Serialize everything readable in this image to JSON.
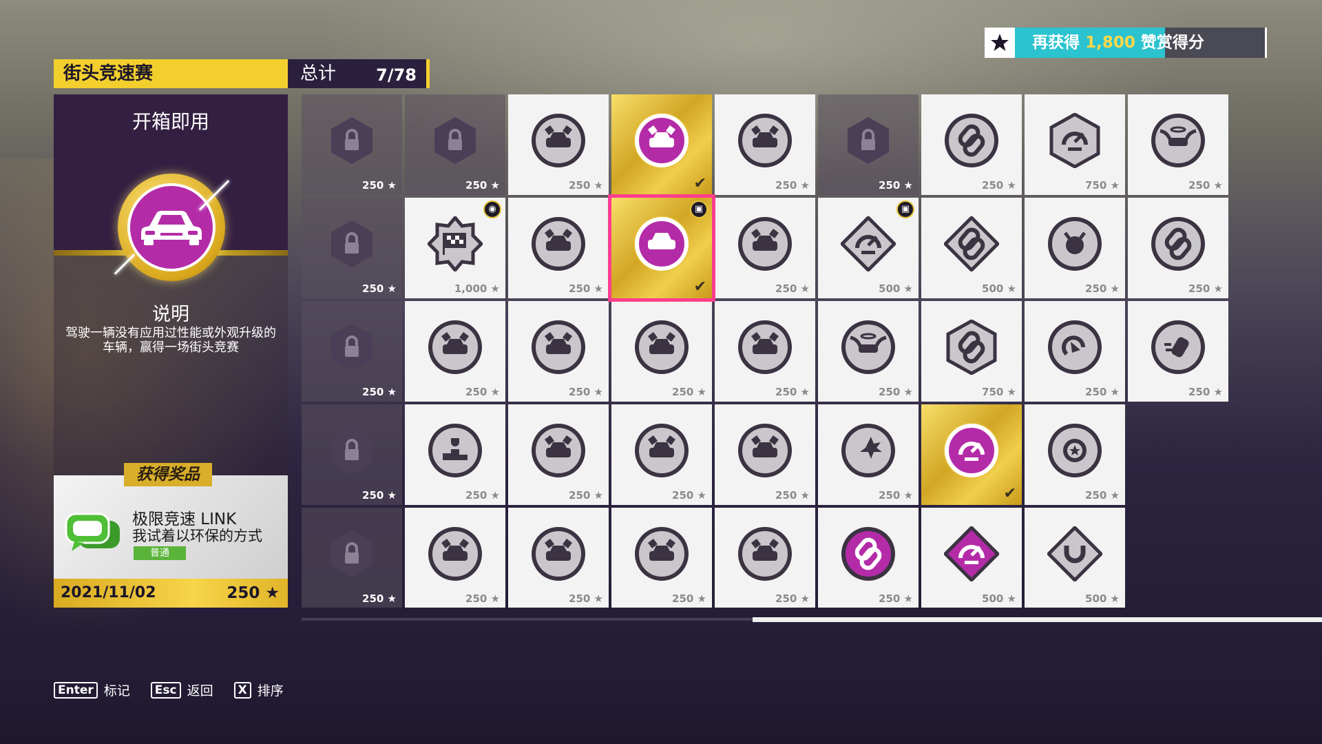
{
  "reward_progress": {
    "prefix": "再获得",
    "amount": "1,800",
    "suffix": "赞赏得分",
    "progress_fraction": 0.6
  },
  "header": {
    "category": "街头竞速赛",
    "total_label": "总计",
    "total_count": "7/78"
  },
  "detail": {
    "name": "开箱即用",
    "desc_heading": "说明",
    "description": "驾驶一辆没有应用过性能或外观升级的车辆，赢得一场街头竞赛",
    "reward_heading": "获得奖品",
    "reward_name": "极限竞速 LINK",
    "reward_subtitle": "我试着以环保的方式",
    "reward_rarity": "普通",
    "date": "2021/11/02",
    "points": "250 ★"
  },
  "colors": {
    "accent_yellow": "#f3cf2e",
    "purple": "#b42ba8",
    "select_pink": "#ff3d8f",
    "progress_cyan": "#2bc3cf"
  },
  "tiles": [
    [
      {
        "state": "locked",
        "points": "250 ★",
        "icon": "lock-icon"
      },
      {
        "state": "locked",
        "points": "250 ★",
        "icon": "lock-icon"
      },
      {
        "state": "normal",
        "points": "250 ★",
        "icon": "race-car-flags-icon"
      },
      {
        "state": "gold",
        "points": "",
        "icon": "race-car-flags-icon",
        "completed": true
      },
      {
        "state": "normal",
        "points": "250 ★",
        "icon": "race-car-flags-icon"
      },
      {
        "state": "locked",
        "points": "250 ★",
        "icon": "lock-icon"
      },
      {
        "state": "normal",
        "points": "250 ★",
        "icon": "chain-link-icon"
      },
      {
        "state": "normal",
        "points": "750 ★",
        "icon": "speedometer-icon",
        "shape": "hex"
      },
      {
        "state": "normal",
        "points": "250 ★",
        "icon": "winged-car-icon"
      }
    ],
    [
      {
        "state": "locked",
        "points": "250 ★",
        "icon": "lock-icon"
      },
      {
        "state": "normal",
        "points": "1,000 ★",
        "icon": "checkered-flag-icon",
        "shape": "star",
        "corner": "car-reward-icon"
      },
      {
        "state": "normal",
        "points": "250 ★",
        "icon": "race-car-flags-icon"
      },
      {
        "state": "gold",
        "points": "",
        "icon": "car-icon",
        "completed": true,
        "selected": true,
        "corner": "gift-icon"
      },
      {
        "state": "normal",
        "points": "250 ★",
        "icon": "race-car-flags-icon"
      },
      {
        "state": "normal",
        "points": "500 ★",
        "icon": "speedometer-icon",
        "shape": "diamond",
        "corner": "gift-icon"
      },
      {
        "state": "normal",
        "points": "500 ★",
        "icon": "chain-link-icon",
        "shape": "diamond"
      },
      {
        "state": "normal",
        "points": "250 ★",
        "icon": "devil-icon"
      },
      {
        "state": "normal",
        "points": "250 ★",
        "icon": "chain-link-icon"
      }
    ],
    [
      {
        "state": "locked",
        "points": "250 ★",
        "icon": "lock-icon"
      },
      {
        "state": "normal",
        "points": "250 ★",
        "icon": "race-car-flags-icon"
      },
      {
        "state": "normal",
        "points": "250 ★",
        "icon": "race-car-flags-icon"
      },
      {
        "state": "normal",
        "points": "250 ★",
        "icon": "race-car-flags-icon"
      },
      {
        "state": "normal",
        "points": "250 ★",
        "icon": "race-car-flags-icon"
      },
      {
        "state": "normal",
        "points": "250 ★",
        "icon": "winged-car-icon"
      },
      {
        "state": "normal",
        "points": "750 ★",
        "icon": "chain-link-icon",
        "shape": "hex"
      },
      {
        "state": "normal",
        "points": "250 ★",
        "icon": "drift-icon"
      },
      {
        "state": "normal",
        "points": "250 ★",
        "icon": "speed-car-icon"
      }
    ],
    [
      {
        "state": "locked",
        "points": "250 ★",
        "icon": "lock-icon"
      },
      {
        "state": "normal",
        "points": "250 ★",
        "icon": "podium-icon"
      },
      {
        "state": "normal",
        "points": "250 ★",
        "icon": "race-car-flags-icon"
      },
      {
        "state": "normal",
        "points": "250 ★",
        "icon": "race-car-flags-icon"
      },
      {
        "state": "normal",
        "points": "250 ★",
        "icon": "race-car-flags-icon"
      },
      {
        "state": "normal",
        "points": "250 ★",
        "icon": "crash-icon"
      },
      {
        "state": "gold",
        "points": "",
        "icon": "speedometer-icon",
        "completed": true
      },
      {
        "state": "normal",
        "points": "250 ★",
        "icon": "wheel-star-icon"
      }
    ],
    [
      {
        "state": "locked",
        "points": "250 ★",
        "icon": "lock-icon"
      },
      {
        "state": "normal",
        "points": "250 ★",
        "icon": "race-car-flags-icon"
      },
      {
        "state": "normal",
        "points": "250 ★",
        "icon": "race-car-flags-icon"
      },
      {
        "state": "normal",
        "points": "250 ★",
        "icon": "race-car-flags-icon"
      },
      {
        "state": "normal",
        "points": "250 ★",
        "icon": "race-car-flags-icon"
      },
      {
        "state": "normal",
        "points": "250 ★",
        "icon": "chain-link-icon",
        "fill": "purple"
      },
      {
        "state": "normal",
        "points": "500 ★",
        "icon": "speedometer-icon",
        "shape": "diamond",
        "fill": "purple"
      },
      {
        "state": "normal",
        "points": "500 ★",
        "icon": "horseshoe-icon",
        "shape": "diamond"
      }
    ]
  ],
  "hints": [
    {
      "key": "Enter",
      "label": "标记"
    },
    {
      "key": "Esc",
      "label": "返回"
    },
    {
      "key": "X",
      "label": "排序"
    }
  ]
}
